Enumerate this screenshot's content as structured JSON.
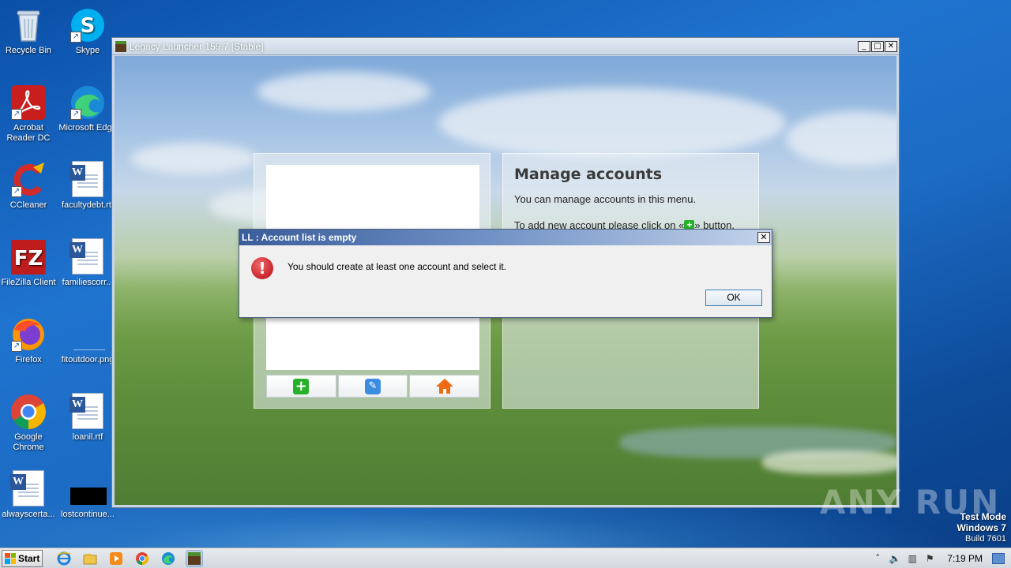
{
  "desktop_icons": [
    {
      "label": "Recycle Bin",
      "icon": "recycle-bin-icon"
    },
    {
      "label": "Skype",
      "icon": "skype-icon"
    },
    {
      "label": "Acrobat Reader DC",
      "line1": "Acrobat",
      "line2": "Reader DC",
      "icon": "acrobat-icon"
    },
    {
      "label": "Microsoft Edge",
      "icon": "edge-icon"
    },
    {
      "label": "CCleaner",
      "icon": "ccleaner-icon"
    },
    {
      "label": "facultydebt.rtf",
      "icon": "word-doc-icon"
    },
    {
      "label": "FileZilla Client",
      "icon": "filezilla-icon"
    },
    {
      "label": "familiescorr...",
      "icon": "word-doc-icon"
    },
    {
      "label": "Firefox",
      "icon": "firefox-icon"
    },
    {
      "label": "fitoutdoor.png",
      "icon": "image-file-icon"
    },
    {
      "label": "Google Chrome",
      "line1": "Google",
      "line2": "Chrome",
      "icon": "chrome-icon"
    },
    {
      "label": "loanil.rtf",
      "icon": "word-doc-icon"
    },
    {
      "label": "alwayscerta...",
      "icon": "word-doc-icon"
    },
    {
      "label": "lostcontinue...",
      "icon": "black-file-icon"
    }
  ],
  "launcher": {
    "title": "Legacy Launcher 159.7 [Stable]",
    "manage": {
      "title": "Manage accounts",
      "line1": "You can manage accounts in this menu.",
      "line2_before": "To add new account please click on «",
      "line2_after": "» button."
    },
    "toolbar": {
      "add_icon": "plus-icon",
      "edit_icon": "pencil-icon",
      "home_icon": "home-icon"
    }
  },
  "dialog": {
    "title": "LL : Account list is empty",
    "message": "You should create at least one account and select it.",
    "ok_label": "OK",
    "close_glyph": "✕",
    "icon": "error-icon"
  },
  "watermark": "ANY RUN",
  "test_mode": {
    "line1": "Test Mode",
    "line2": "Windows 7",
    "line3": "Build 7601"
  },
  "taskbar": {
    "start_label": "Start",
    "clock": "7:19 PM",
    "pinned": [
      "ie-icon",
      "explorer-icon",
      "media-player-icon",
      "chrome-icon",
      "edge-icon",
      "minecraft-icon"
    ]
  },
  "colors": {
    "dialog_title_gradient_start": "#3a5d9b",
    "add_green": "#27b02a",
    "edit_blue": "#3c8de0",
    "home_orange": "#f06a14",
    "error_red": "#c8242b"
  }
}
